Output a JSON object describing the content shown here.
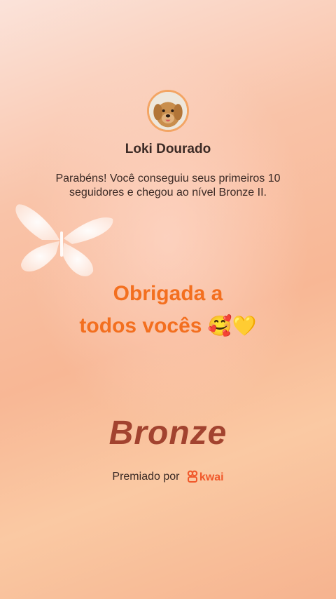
{
  "profile": {
    "name": "Loki Dourado",
    "message": "Parabéns! Você conseguiu seus primeiros 10 seguidores e chegou ao nível Bronze II."
  },
  "caption": {
    "line1": "Obrigada a",
    "line2": "todos vocês",
    "emojis": "🥰💛"
  },
  "award": {
    "level": "Bronze",
    "awarded_by_label": "Premiado por",
    "brand": "kwai"
  },
  "icons": [
    "avatar-dog-photo",
    "butterfly-icon",
    "kwai-logo-icon"
  ],
  "colors": {
    "caption": "#f36f1f",
    "level": "#a2432f",
    "brand": "#f0582a",
    "avatar_ring": "#f3a564"
  }
}
